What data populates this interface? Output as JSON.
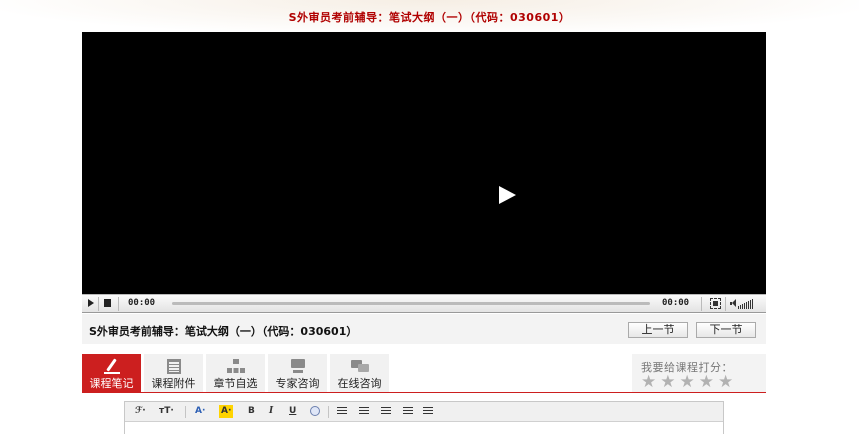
{
  "page": {
    "course_title": "S外审员考前辅导：笔试大纲（一）（代码：030601）"
  },
  "player": {
    "current_time": "00:00",
    "total_time": "00:00",
    "progress": 0
  },
  "info_bar": {
    "title": "S外审员考前辅导：笔试大纲（一）（代码：030601）",
    "prev_label": "上一节",
    "next_label": "下一节"
  },
  "tabs": [
    {
      "label": "课程笔记",
      "icon": "pen-icon",
      "active": true
    },
    {
      "label": "课程附件",
      "icon": "book-icon",
      "active": false
    },
    {
      "label": "章节自选",
      "icon": "tree-icon",
      "active": false
    },
    {
      "label": "专家咨询",
      "icon": "expert-icon",
      "active": false
    },
    {
      "label": "在线咨询",
      "icon": "chat-icon",
      "active": false
    }
  ],
  "rating": {
    "label": "我要给课程打分：",
    "stars": [
      "★",
      "★",
      "★",
      "★",
      "★"
    ],
    "value": 0
  },
  "editor": {
    "font_family_btn": "ℱ·",
    "font_size_btn": "ᴛT·",
    "font_color_btn": "A·",
    "highlight_btn": "A·",
    "bold_btn": "B",
    "italic_btn": "I",
    "underline_btn": "U"
  },
  "colors": {
    "title_red": "#b00000",
    "active_tab": "#cc1f1f",
    "star_inactive": "#b2b2b2"
  }
}
